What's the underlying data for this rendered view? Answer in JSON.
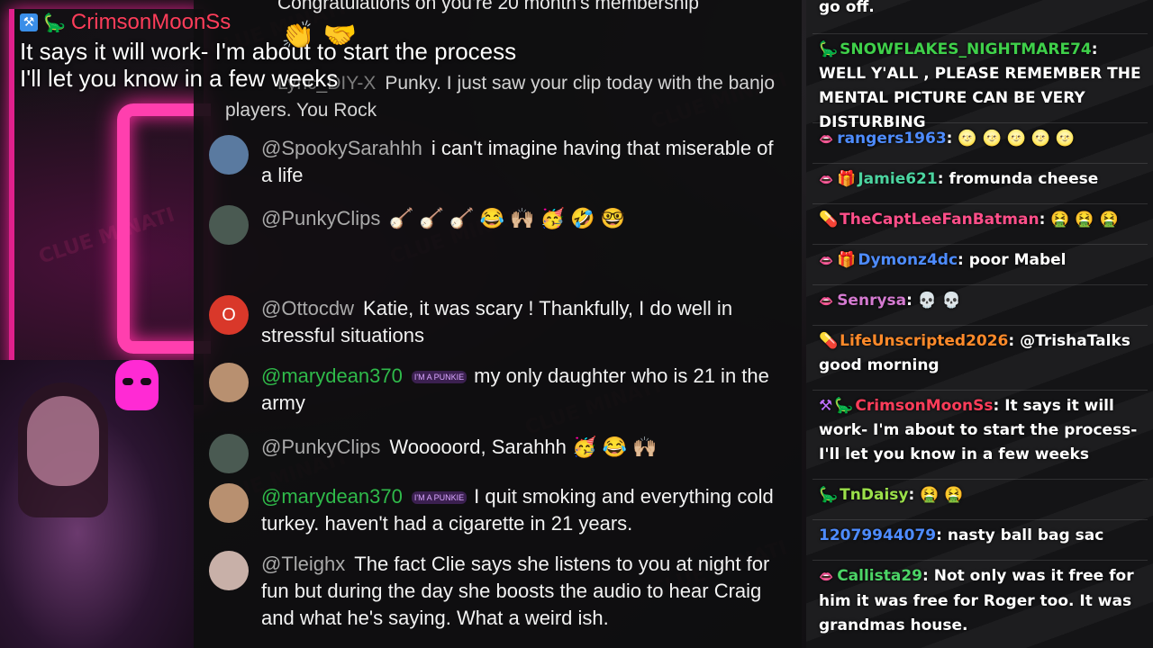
{
  "overlay": {
    "username": "CrimsonMoonSs",
    "line1": "It says it will work- I'm about to start the process",
    "line2": "I'll let you know in a few weeks"
  },
  "watermark": "CLUE MINATI",
  "youtube_chat": {
    "top_partial": "Congratulations on you're 20 month's membership",
    "top_emoji": "👏 🤝",
    "faded": {
      "author": "Lyric_DIY-X",
      "text": "Punky. I just saw your clip today with the banjo players. You Rock"
    },
    "messages": [
      {
        "author": "@SpookySarahhh",
        "text": "i can't imagine having that miserable of a life",
        "avatar_color": "#5a7aa0",
        "initial": "",
        "member": false
      },
      {
        "author": "@PunkyClips",
        "text": "🪕 🪕 🪕 😂 🙌🏼 🥳 🤣 🤓",
        "avatar_color": "#4a5a52",
        "initial": "",
        "member": false
      },
      {
        "author": "@Ottocdw",
        "text": "Katie, it was scary ! Thankfully, I do well in stressful situations",
        "avatar_color": "#d9382a",
        "initial": "O",
        "member": false
      },
      {
        "author": "@marydean370",
        "text": "my only daughter who is 21 in the army",
        "avatar_color": "#b89070",
        "initial": "",
        "member": true,
        "badge": "I'M A PUNKIE"
      },
      {
        "author": "@PunkyClips",
        "text": "Wooooord, Sarahhh 🥳 😂 🙌🏼",
        "avatar_color": "#4a5a52",
        "initial": "",
        "member": false
      },
      {
        "author": "@marydean370",
        "text": "I quit smoking and everything cold turkey. haven't had a cigarette in 21 years.",
        "avatar_color": "#b89070",
        "initial": "",
        "member": true,
        "badge": "I'M A PUNKIE"
      },
      {
        "author": "@Tleighx",
        "text": "The fact Clie says she listens to you at night for fun but during the day she boosts the audio to hear Craig and what he's saying. What a weird ish.",
        "avatar_color": "#c8b0a8",
        "initial": "",
        "member": false
      }
    ]
  },
  "twitch_chat": {
    "messages": [
      {
        "user": "",
        "text": "go off.",
        "color": "#ffffff",
        "badge": ""
      },
      {
        "user": "SNOWFLAKES_NIGHTMARE74",
        "text": "WELL Y'ALL , PLEASE REMEMBER THE MENTAL PICTURE CAN BE VERY DISTURBING",
        "color": "#3fd04a",
        "badge": "dino"
      },
      {
        "user": "rangers1963",
        "text": "🌝 🌝 🌝 🌝 🌝",
        "color": "#4e8cff",
        "badge": "lip"
      },
      {
        "user": "Jamie621",
        "text": "fromunda cheese",
        "color": "#4cd4a0",
        "badge": "lip-gift"
      },
      {
        "user": "TheCaptLeeFanBatman",
        "text": "🤮 🤮 🤮",
        "color": "#ff4f8a",
        "badge": "pill"
      },
      {
        "user": "Dymonz4dc",
        "text": "poor Mabel",
        "color": "#4e8cff",
        "badge": "lip-gift2"
      },
      {
        "user": "Senrysa",
        "text": "💀 💀",
        "color": "#d47ad0",
        "badge": "lip"
      },
      {
        "user": "LifeUnscripted2026",
        "text": "@TrishaTalks good morning",
        "color": "#ff8a2a",
        "badge": "pill"
      },
      {
        "user": "CrimsonMoonSs",
        "text": "It says it will work- I'm about to start the process- I'll let you know in a few weeks",
        "color": "#ff3d5a",
        "badge": "sq-dino"
      },
      {
        "user": "TnDaisy",
        "text": "🤮 🤮",
        "color": "#9be04a",
        "badge": "dino"
      },
      {
        "user": "12079944079",
        "text": "nasty ball bag sac",
        "color": "#4e8cff",
        "badge": ""
      },
      {
        "user": "Callista29",
        "text": "Not only was it free for him it was free for Roger too. It was grandmas house.",
        "color": "#4cd466",
        "badge": "lip"
      }
    ]
  }
}
